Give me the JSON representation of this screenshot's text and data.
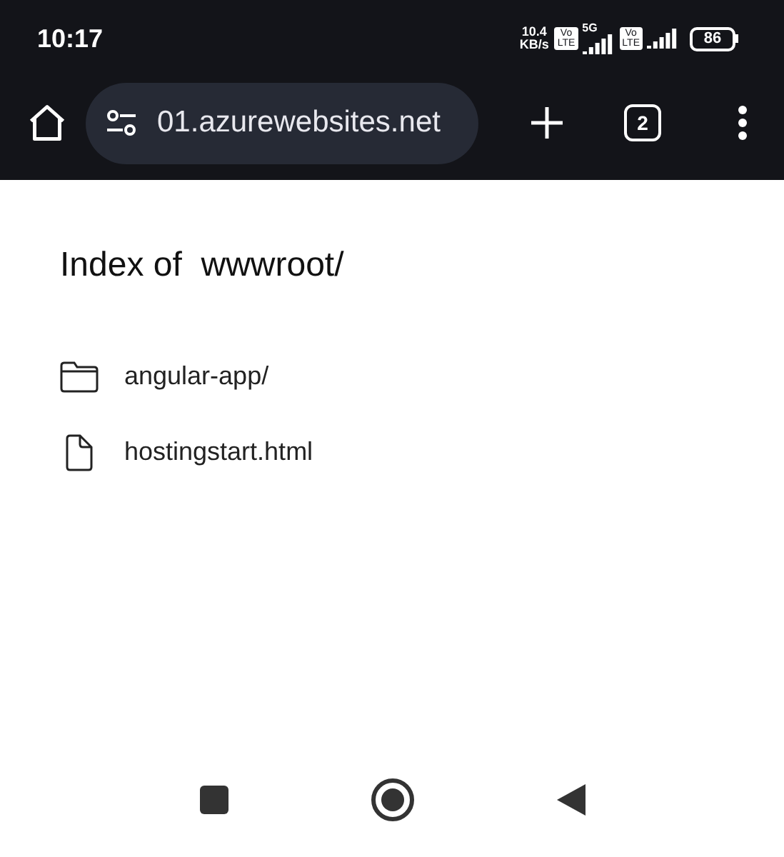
{
  "status_bar": {
    "time": "10:17",
    "speed": "10.4",
    "speed_unit": "KB/s",
    "sim_badges": [
      {
        "top": "Vo",
        "bottom": "LTE",
        "network": "5G"
      },
      {
        "top": "Vo",
        "bottom": "LTE"
      }
    ],
    "battery": "86"
  },
  "toolbar": {
    "url": "01.azurewebsites.net",
    "tab_count": "2"
  },
  "page": {
    "title": "Index of  wwwroot/",
    "entries": [
      {
        "kind": "folder",
        "name": "angular-app/"
      },
      {
        "kind": "file",
        "name": "hostingstart.html"
      }
    ]
  }
}
